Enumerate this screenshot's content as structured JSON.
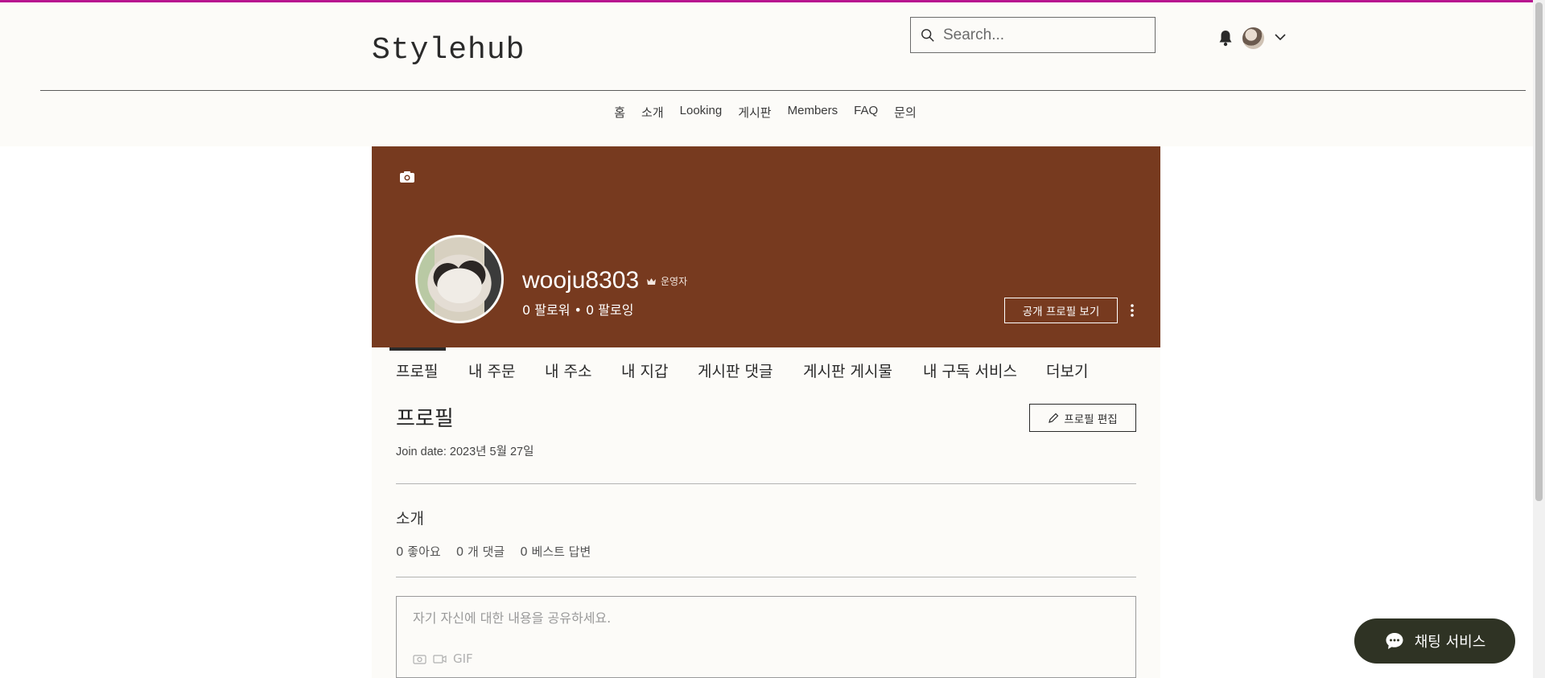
{
  "header": {
    "logo": "Stylehub",
    "search_placeholder": "Search..."
  },
  "nav": [
    "홈",
    "소개",
    "Looking",
    "게시판",
    "Members",
    "FAQ",
    "문의"
  ],
  "profile": {
    "username": "wooju8303",
    "role": "운영자",
    "follow_stats": "0 팔로워 • 0 팔로잉",
    "public_profile_btn": "공개 프로필 보기",
    "cover_color": "#773a1f"
  },
  "tabs": [
    "프로필",
    "내 주문",
    "내 주소",
    "내 지갑",
    "게시판 댓글",
    "게시판 게시물",
    "내 구독 서비스",
    "더보기"
  ],
  "section": {
    "title": "프로필",
    "edit_btn": "프로필 편집",
    "join_date": "Join date: 2023년 5월 27일",
    "about_title": "소개",
    "stats": [
      "0 좋아요",
      "0 개 댓글",
      "0 베스트 답변"
    ],
    "composer_placeholder": "자기 자신에 대한 내용을 공유하세요.",
    "gif_label": "GIF"
  },
  "chat": {
    "label": "채팅 서비스"
  }
}
